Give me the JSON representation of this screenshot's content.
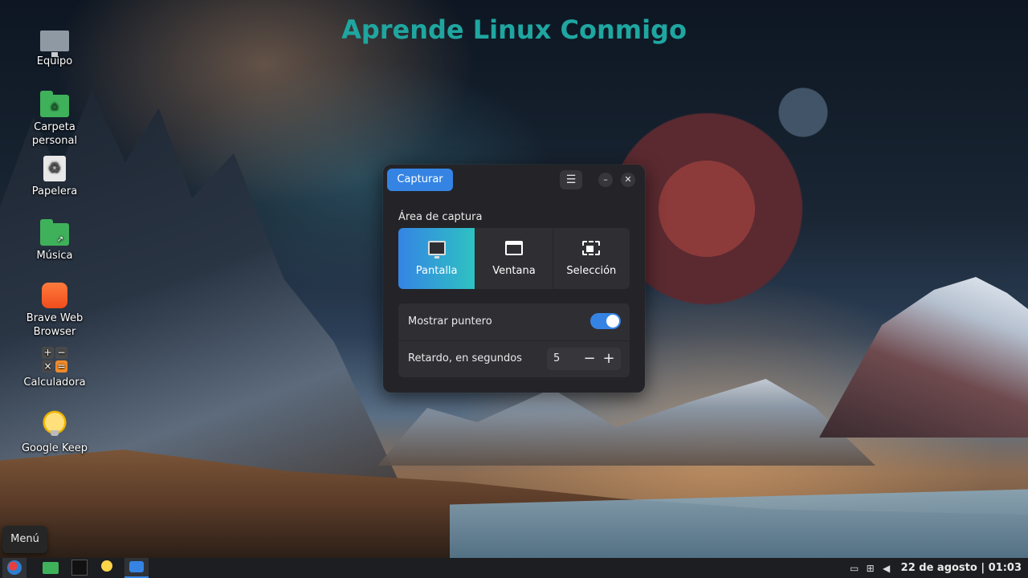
{
  "desktop": {
    "watermark": "Aprende Linux Conmigo",
    "icons": [
      {
        "label": "Equipo",
        "icon": "computer-icon"
      },
      {
        "label": "Carpeta personal",
        "icon": "home-folder-icon"
      },
      {
        "label": "Papelera",
        "icon": "trash-icon"
      },
      {
        "label": "Música",
        "icon": "music-folder-icon"
      },
      {
        "label": "Brave Web Browser",
        "icon": "brave-browser-icon"
      },
      {
        "label": "Calculadora",
        "icon": "calculator-icon"
      },
      {
        "label": "Google Keep",
        "icon": "google-keep-icon"
      }
    ]
  },
  "dialog": {
    "capture_button": "Capturar",
    "area_label": "Área de captura",
    "area_options": [
      {
        "label": "Pantalla",
        "icon": "screen-icon",
        "selected": true
      },
      {
        "label": "Ventana",
        "icon": "window-icon",
        "selected": false
      },
      {
        "label": "Selección",
        "icon": "selection-icon",
        "selected": false
      }
    ],
    "show_pointer_label": "Mostrar puntero",
    "show_pointer_on": true,
    "delay_label": "Retardo, en segundos",
    "delay_value": "5",
    "colors": {
      "accent": "#3584e4",
      "accent_gradient_end": "#2ec2c2",
      "bg": "#242428",
      "panel": "#2e2e33"
    }
  },
  "menu_tooltip": "Menú",
  "taskbar": {
    "apps": [
      "menu-icon",
      "file-manager-icon",
      "terminal-icon",
      "google-keep-icon",
      "screenshot-icon"
    ],
    "tray_icons": [
      "printer-icon",
      "network-icon",
      "volume-icon"
    ],
    "clock": "22 de agosto | 01:03"
  }
}
